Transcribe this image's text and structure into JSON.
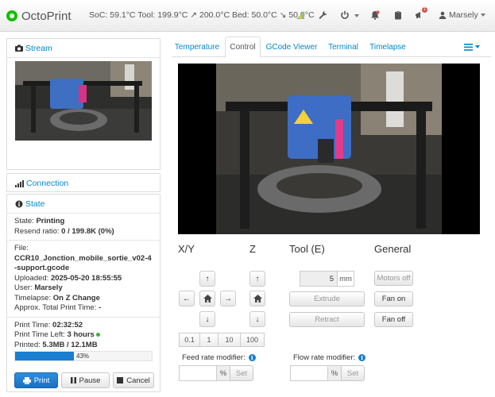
{
  "navbar": {
    "brand": "OctoPrint",
    "status": "SoC: 59.1°C Tool: 199.9°C ↗ 200.0°C Bed: 50.0°C ↘ 50.0°C",
    "notification_badge": "1",
    "user": "Marsely",
    "accent_color": "#13c100"
  },
  "sidebar": {
    "stream": {
      "title": "Stream"
    },
    "connection": {
      "title": "Connection"
    },
    "state": {
      "title": "State",
      "state_label": "State:",
      "state_value": "Printing",
      "resend_label": "Resend ratio:",
      "resend_value": "0 / 199.8K (0%)",
      "file_label": "File:",
      "file_value": "CCR10_Jonction_mobile_sortie_v02-4-support.gcode",
      "uploaded_label": "Uploaded:",
      "uploaded_value": "2025-05-20 18:55:55",
      "user_label": "User:",
      "user_value": "Marsely",
      "timelapse_label": "Timelapse:",
      "timelapse_value": "On Z Change",
      "approx_label": "Approx. Total Print Time:",
      "approx_value": "-",
      "print_time_label": "Print Time:",
      "print_time_value": "02:32:52",
      "time_left_label": "Print Time Left:",
      "time_left_value": "3 hours",
      "printed_label": "Printed:",
      "printed_value": "5.3MB / 12.1MB",
      "progress_percent": 43,
      "progress_label": "43%"
    },
    "buttons": {
      "print": "Print",
      "pause": "Pause",
      "cancel": "Cancel"
    }
  },
  "tabs": [
    {
      "label": "Temperature",
      "active": false
    },
    {
      "label": "Control",
      "active": true
    },
    {
      "label": "GCode Viewer",
      "active": false
    },
    {
      "label": "Terminal",
      "active": false
    },
    {
      "label": "Timelapse",
      "active": false
    }
  ],
  "control": {
    "xy_title": "X/Y",
    "z_title": "Z",
    "tool_title": "Tool (E)",
    "general_title": "General",
    "step_sizes": [
      "0.1",
      "1",
      "10",
      "100"
    ],
    "extrude_amount": "5",
    "extrude_unit": "mm",
    "extrude_label": "Extrude",
    "retract_label": "Retract",
    "motors_off_label": "Motors off",
    "fan_on_label": "Fan on",
    "fan_off_label": "Fan off",
    "feed_rate_label": "Feed rate modifier:",
    "flow_rate_label": "Flow rate modifier:",
    "percent_unit": "%",
    "set_label": "Set"
  }
}
